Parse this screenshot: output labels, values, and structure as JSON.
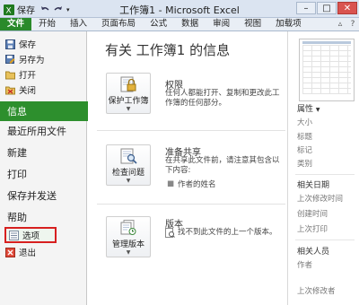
{
  "window": {
    "title": "工作簿1 - Microsoft Excel",
    "save_label": "保存"
  },
  "ribbon": {
    "tabs": [
      "文件",
      "开始",
      "插入",
      "页面布局",
      "公式",
      "数据",
      "审阅",
      "视图",
      "加载项"
    ]
  },
  "backstage": {
    "small_items": [
      "保存",
      "另存为",
      "打开",
      "关闭"
    ],
    "big_items": [
      "信息",
      "最近所用文件",
      "新建",
      "打印",
      "保存并发送",
      "帮助"
    ],
    "options_label": "选项",
    "exit_label": "退出"
  },
  "info": {
    "heading": "有关 工作簿1 的信息",
    "sections": [
      {
        "button": "保护工作簿",
        "title": "权限",
        "desc": "任何人都能打开、复制和更改此工作簿的任何部分。"
      },
      {
        "button": "检查问题",
        "title": "准备共享",
        "desc": "在共享此文件前，请注意其包含以下内容:",
        "bullet": "作者的姓名"
      },
      {
        "button": "管理版本",
        "title": "版本",
        "desc": "找不到此文件的上一个版本。"
      }
    ]
  },
  "properties": {
    "header": "属性",
    "items": [
      "大小",
      "标题",
      "标记",
      "类别"
    ],
    "dates_header": "相关日期",
    "dates": [
      "上次修改时间",
      "创建时间",
      "上次打印"
    ],
    "people_header": "相关人员",
    "people": [
      "作者",
      "上次修改者"
    ]
  },
  "colors": {
    "file_tab": "#2a8a2a",
    "active": "#2d8f2d",
    "highlight": "#d71f1f"
  },
  "icons": {
    "qat": [
      "save-icon",
      "undo-icon",
      "redo-icon"
    ],
    "window_buttons": [
      "minimize-icon",
      "maximize-icon",
      "close-icon"
    ],
    "backstage": [
      "save-icon",
      "save-as-icon",
      "open-folder-icon",
      "close-file-icon",
      "options-icon",
      "exit-icon"
    ],
    "info": [
      "lock-key-icon",
      "inspect-document-icon",
      "versions-icon"
    ]
  }
}
